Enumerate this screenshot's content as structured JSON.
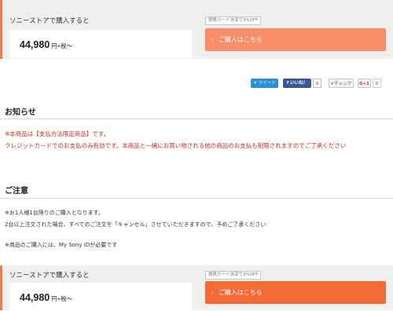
{
  "purchase_top": {
    "store_label": "ソニーストアで購入すると",
    "price": "44,980",
    "price_suffix": "円+税～",
    "card_badge": "提携カード決済で3%OFF",
    "buy_button": "ご購入はこちら",
    "button_color": "#f88d6a"
  },
  "social": {
    "tweet": "ツイート",
    "facebook_like": "いいね！",
    "facebook_count": "0",
    "mixi_check": "チェック",
    "gplus": "G+1",
    "gplus_count": "0"
  },
  "notice": {
    "title": "お知らせ",
    "line1": "※本商品は【支払方法限定商品】です。",
    "line2": "クレジットカードでのお支払のみ有効です。本商品と一緒にお買い物される他の商品のお支払も制限されますのでご了承ください"
  },
  "caution": {
    "title": "ご注意",
    "line1": "※お1人様1台限りのご購入となります。",
    "line2": "2台以上注文された場合、すべてのご注文を「キャンセル」させていただきますので、予めご了承ください",
    "line3": "※商品のご購入には、My Sony IDが必要です"
  },
  "purchase_bottom": {
    "store_label": "ソニーストアで購入すると",
    "price": "44,980",
    "price_suffix": "円+税～",
    "card_badge": "提携カード決済で3%OFF",
    "buy_button": "ご購入はこちら",
    "button_color": "#f36a35"
  }
}
